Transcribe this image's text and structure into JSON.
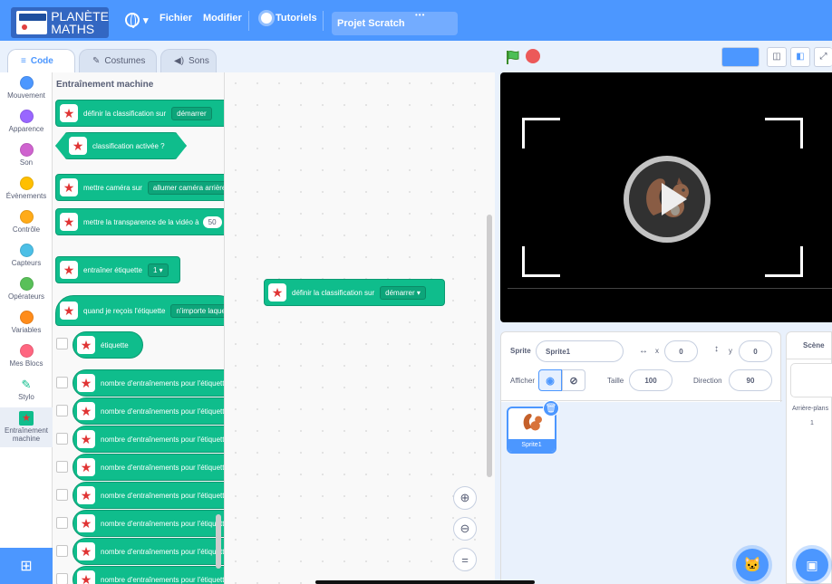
{
  "menubar": {
    "logo_line1": "PLANÈTE",
    "logo_line2": "MATHS",
    "file": "Fichier",
    "edit": "Modifier",
    "tutorials": "Tutoriels",
    "project_title": "Projet Scratch",
    "more": "•••"
  },
  "tabs": {
    "code": "Code",
    "costumes": "Costumes",
    "sounds": "Sons"
  },
  "categories": [
    {
      "label": "Mouvement",
      "color": "#4c97ff"
    },
    {
      "label": "Apparence",
      "color": "#9966ff"
    },
    {
      "label": "Son",
      "color": "#cf63cf"
    },
    {
      "label": "Évènements",
      "color": "#ffbf00"
    },
    {
      "label": "Contrôle",
      "color": "#ffab19"
    },
    {
      "label": "Capteurs",
      "color": "#4cbfe6"
    },
    {
      "label": "Opérateurs",
      "color": "#59c059"
    },
    {
      "label": "Variables",
      "color": "#ff8c1a"
    },
    {
      "label": "Mes Blocs",
      "color": "#ff6680"
    },
    {
      "label": "Stylo",
      "color": "#0fbd8c"
    },
    {
      "label": "Entraînement machine",
      "color": "#0fbd8c"
    }
  ],
  "palette": {
    "title": "Entraînement machine",
    "blocks": {
      "set_classification": "définir la classification sur",
      "set_classification_value": "démarrer",
      "classification_active": "classification activée ?",
      "camera": "mettre caméra sur",
      "camera_value": "allumer caméra arrière",
      "transparency": "mettre la transparence de la vidéo à",
      "transparency_value": "50",
      "train_label": "entraîner étiquette",
      "train_label_value": "1",
      "when_receive": "quand je reçois l'étiquette",
      "when_receive_value": "n'importe laquelle",
      "label": "étiquette",
      "trainings_count": "nombre d'entraînements pour l'étiquette"
    }
  },
  "workspace": {
    "block_text": "définir la classification sur",
    "block_value": "démarrer",
    "zoom_in": "⊕",
    "zoom_out": "⊖",
    "zoom_reset": "="
  },
  "sprite_info": {
    "sprite_label": "Sprite",
    "sprite_name": "Sprite1",
    "x_label": "x",
    "x_value": "0",
    "y_label": "y",
    "y_value": "0",
    "show_label": "Afficher",
    "size_label": "Taille",
    "size_value": "100",
    "direction_label": "Direction",
    "direction_value": "90",
    "thumb_name": "Sprite1"
  },
  "stage_pane": {
    "title": "Scène",
    "backdrops_label": "Arrière-plans",
    "backdrops_count": "1"
  }
}
